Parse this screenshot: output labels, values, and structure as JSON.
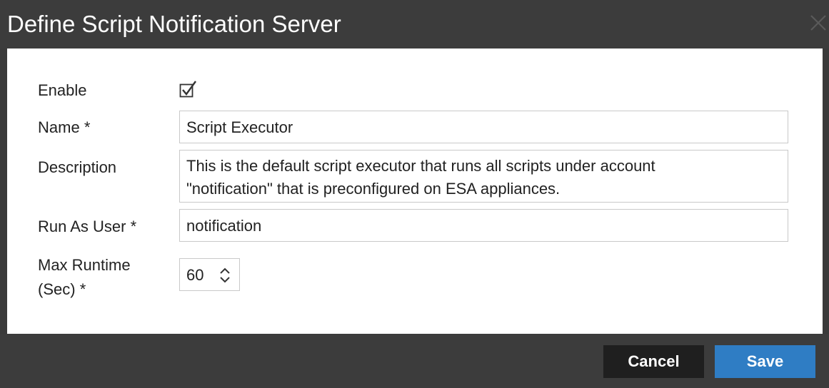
{
  "dialog": {
    "title": "Define Script Notification Server"
  },
  "form": {
    "enable": {
      "label": "Enable",
      "checked": true
    },
    "name": {
      "label": "Name",
      "required_mark": "*",
      "value": "Script Executor"
    },
    "description": {
      "label": "Description",
      "value_line1": "This is the default script executor that runs all scripts under account",
      "value_line2": "\"notification\" that is preconfigured on ESA appliances."
    },
    "run_as_user": {
      "label": "Run As User",
      "required_mark": "*",
      "value": "notification"
    },
    "max_runtime": {
      "label_line1": "Max Runtime",
      "label_line2": "(Sec)",
      "required_mark": "*",
      "value": "60"
    }
  },
  "footer": {
    "cancel_label": "Cancel",
    "save_label": "Save"
  },
  "colors": {
    "titlebar": "#3c3c3c",
    "primary_button": "#2f7dc4",
    "secondary_button": "#1f1f1f"
  },
  "icons": {
    "close": "close-icon",
    "checkbox": "checkmark-icon",
    "stepper": "up-down-arrows-icon"
  }
}
